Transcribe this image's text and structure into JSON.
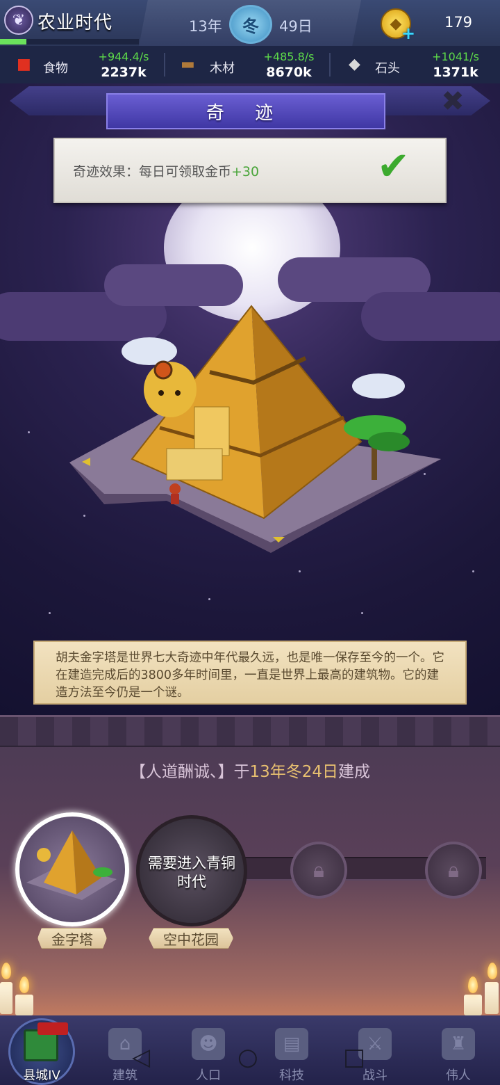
{
  "header": {
    "era_title": "农业时代",
    "era_icon": "wheat-icon",
    "era_progress": 0.19,
    "year": "13年",
    "season": "冬",
    "day": "49日",
    "coins": "179",
    "coin_icon": "gold-coin-icon"
  },
  "resources": [
    {
      "name": "食物",
      "icon": "apple-icon",
      "rate": "+944.4/s",
      "total": "2237k"
    },
    {
      "name": "木材",
      "icon": "wood-icon",
      "rate": "+485.8/s",
      "total": "8670k"
    },
    {
      "name": "石头",
      "icon": "stone-icon",
      "rate": "+1041/s",
      "total": "1371k"
    }
  ],
  "wonder": {
    "panel_title": "奇 迹",
    "effect_label": "奇迹效果：每日可领取金币",
    "effect_bonus": "+30",
    "description": "胡夫金字塔是世界七大奇迹中年代最久远，也是唯一保存至今的一个。它在建造完成后的3800多年时间里，一直是世界上最高的建筑物。它的建造方法至今仍是一个谜。"
  },
  "built_info": {
    "prefix": "【人道酬诚、】于",
    "date": "13年冬24日",
    "suffix": "建成"
  },
  "wonder_slots": [
    {
      "label": "金字塔",
      "state": "built"
    },
    {
      "label": "空中花园",
      "state": "locked",
      "lock_text": "需要进入青铜时代"
    }
  ],
  "nav": [
    {
      "label": "县城IV",
      "icon": "castle-icon"
    },
    {
      "label": "建筑",
      "icon": "house-icon"
    },
    {
      "label": "人口",
      "icon": "person-icon"
    },
    {
      "label": "科技",
      "icon": "book-icon"
    },
    {
      "label": "战斗",
      "icon": "swords-icon"
    },
    {
      "label": "伟人",
      "icon": "statue-icon"
    }
  ],
  "colors": {
    "positive_rate": "#5edc4a",
    "bonus": "#4aa53a",
    "highlight": "#e8c070"
  }
}
